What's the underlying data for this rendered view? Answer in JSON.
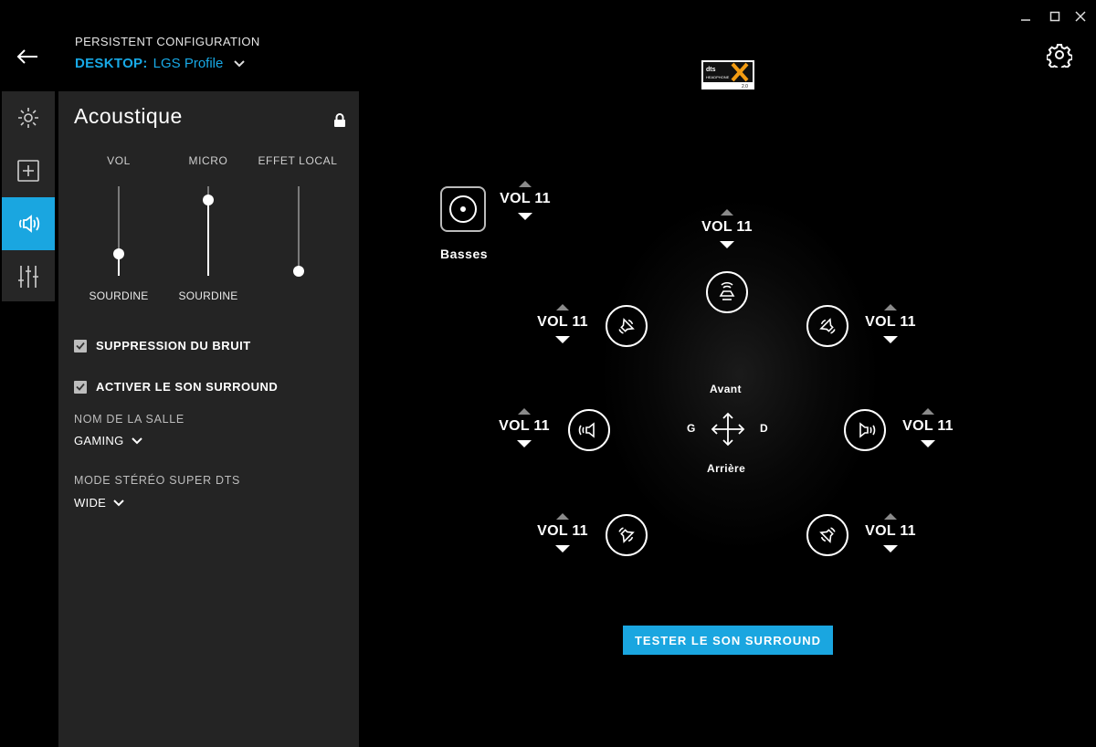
{
  "window": {
    "minimize_icon": "minimize-icon",
    "maximize_icon": "maximize-icon",
    "close_icon": "close-icon"
  },
  "header": {
    "overline": "PERSISTENT CONFIGURATION",
    "profile_key": "DESKTOP:",
    "profile_name": "LGS Profile",
    "accent": "#1aa6e0"
  },
  "sidenav": {
    "items": [
      {
        "name": "lighting",
        "icon": "sun-icon",
        "active": false
      },
      {
        "name": "assignments",
        "icon": "plus-square-icon",
        "active": false
      },
      {
        "name": "acoustics",
        "icon": "speaker-icon",
        "active": true
      },
      {
        "name": "equalizer",
        "icon": "sliders-icon",
        "active": false
      }
    ]
  },
  "panel": {
    "title": "Acoustique",
    "sliders": [
      {
        "label": "VOL",
        "sub": "SOURDINE",
        "level": 0.25
      },
      {
        "label": "MICRO",
        "sub": "SOURDINE",
        "level": 0.85
      },
      {
        "label": "EFFET LOCAL",
        "sub": "",
        "level": 0.05
      }
    ],
    "noise_suppression": {
      "label": "SUPPRESSION DU BRUIT",
      "checked": true
    },
    "surround_enable": {
      "label": "ACTIVER LE SON SURROUND",
      "checked": true
    },
    "room": {
      "label": "NOM DE LA SALLE",
      "value": "GAMING"
    },
    "dts_mode": {
      "label": "MODE STÉRÉO SUPER DTS",
      "value": "WIDE"
    }
  },
  "surround": {
    "bass": {
      "label": "Basses",
      "volume": "VOL 11"
    },
    "channels": {
      "center": "VOL 11",
      "front_left": "VOL 11",
      "front_right": "VOL 11",
      "left": "VOL 11",
      "right": "VOL 11",
      "rear_left": "VOL 11",
      "rear_right": "VOL 11"
    },
    "directions": {
      "front": "Avant",
      "left": "G",
      "right": "D",
      "rear": "Arrière"
    },
    "test_button": "TESTER LE SON SURROUND"
  }
}
